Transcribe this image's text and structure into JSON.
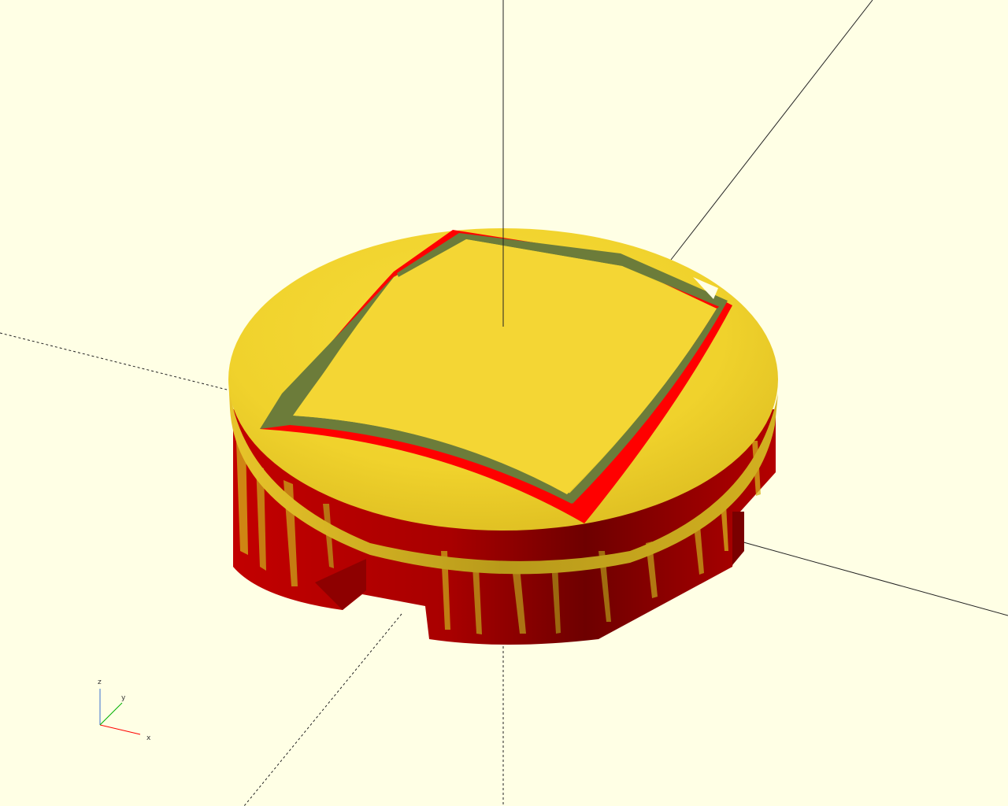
{
  "viewport": {
    "background": "#ffffe5"
  },
  "axes": {
    "x_label": "x",
    "y_label": "y",
    "z_label": "z",
    "x_color": "#ff0000",
    "y_color": "#00b000",
    "z_color": "#3a6fd0"
  },
  "model": {
    "top_color": "#f2d42a",
    "side_color": "#c80000",
    "edge_red": "#ff0000",
    "edge_green": "#6c7c3a"
  }
}
